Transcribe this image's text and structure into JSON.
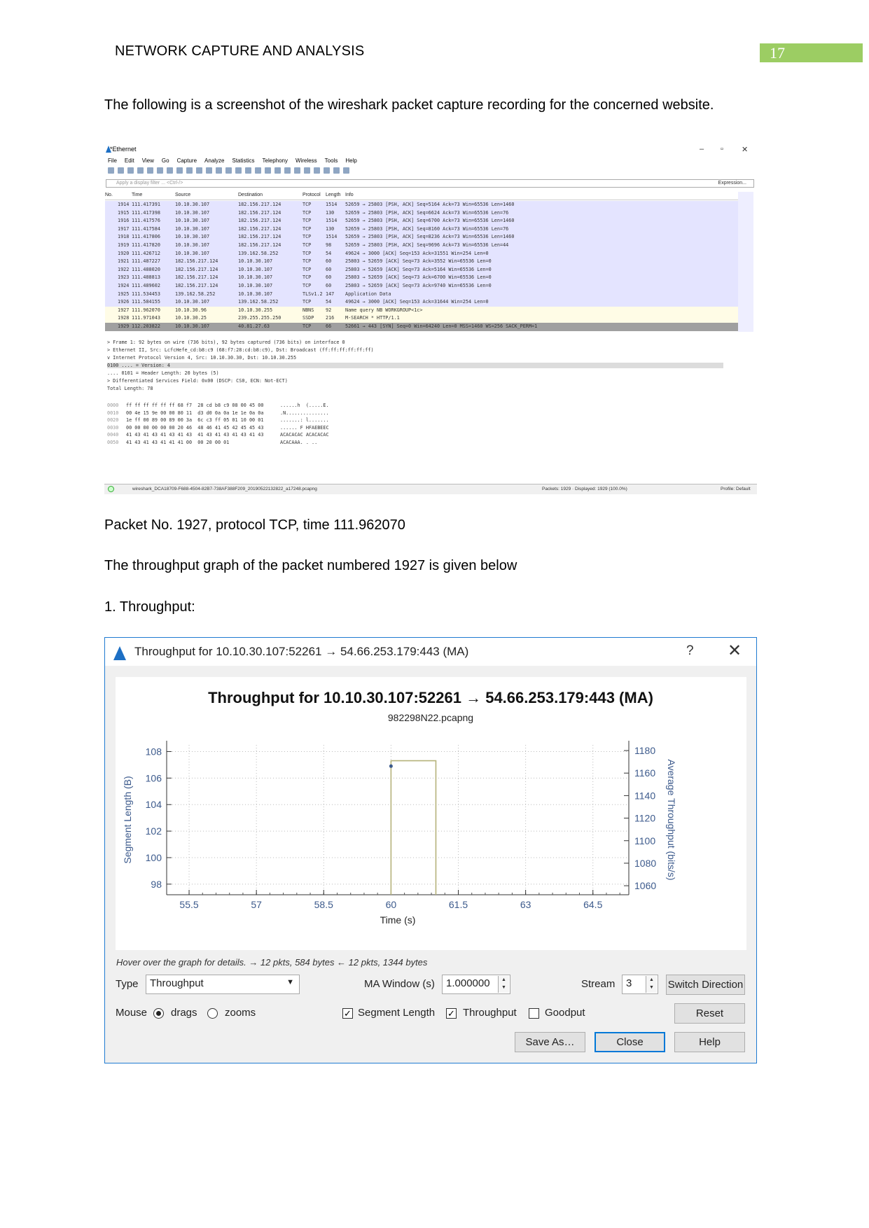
{
  "header": {
    "title": "NETWORK CAPTURE AND ANALYSIS",
    "page_number": "17"
  },
  "paragraphs": {
    "intro": "The following is a screenshot of the wireshark packet capture recording for the concerned website.",
    "packet_info": "Packet No. 1927, protocol TCP, time 111.962070",
    "graph_intro": "The throughput graph of the packet numbered 1927 is given below",
    "section": "1. Throughput:"
  },
  "wireshark": {
    "title": "*Ethernet",
    "menu": [
      "File",
      "Edit",
      "View",
      "Go",
      "Capture",
      "Analyze",
      "Statistics",
      "Telephony",
      "Wireless",
      "Tools",
      "Help"
    ],
    "filter_placeholder": "Apply a display filter ... <Ctrl-/>",
    "expression": "Expression...",
    "columns": [
      "No.",
      "Time",
      "Source",
      "Destination",
      "Protocol",
      "Length",
      "Info"
    ],
    "rows": [
      [
        "1914",
        "111.417391",
        "10.10.30.107",
        "182.156.217.124",
        "TCP",
        "1514",
        "52659 → 25803 [PSH, ACK] Seq=5164 Ack=73 Win=65536 Len=1460"
      ],
      [
        "1915",
        "111.417398",
        "10.10.30.107",
        "182.156.217.124",
        "TCP",
        "130",
        "52659 → 25803 [PSH, ACK] Seq=6624 Ack=73 Win=65536 Len=76"
      ],
      [
        "1916",
        "111.417576",
        "10.10.30.107",
        "182.156.217.124",
        "TCP",
        "1514",
        "52659 → 25803 [PSH, ACK] Seq=6700 Ack=73 Win=65536 Len=1460"
      ],
      [
        "1917",
        "111.417584",
        "10.10.30.107",
        "182.156.217.124",
        "TCP",
        "130",
        "52659 → 25803 [PSH, ACK] Seq=8160 Ack=73 Win=65536 Len=76"
      ],
      [
        "1918",
        "111.417806",
        "10.10.30.107",
        "182.156.217.124",
        "TCP",
        "1514",
        "52659 → 25803 [PSH, ACK] Seq=8236 Ack=73 Win=65536 Len=1460"
      ],
      [
        "1919",
        "111.417820",
        "10.10.30.107",
        "182.156.217.124",
        "TCP",
        "98",
        "52659 → 25803 [PSH, ACK] Seq=9696 Ack=73 Win=65536 Len=44"
      ],
      [
        "1920",
        "111.426712",
        "10.10.30.107",
        "139.162.58.252",
        "TCP",
        "54",
        "49624 → 3000 [ACK] Seq=153 Ack=31551 Win=254 Len=0"
      ],
      [
        "1921",
        "111.487227",
        "182.156.217.124",
        "10.10.30.107",
        "TCP",
        "60",
        "25803 → 52659 [ACK] Seq=73 Ack=3552 Win=65536 Len=0"
      ],
      [
        "1922",
        "111.488020",
        "182.156.217.124",
        "10.10.30.107",
        "TCP",
        "60",
        "25803 → 52659 [ACK] Seq=73 Ack=5164 Win=65536 Len=0"
      ],
      [
        "1923",
        "111.488813",
        "182.156.217.124",
        "10.10.30.107",
        "TCP",
        "60",
        "25803 → 52659 [ACK] Seq=73 Ack=6700 Win=65536 Len=0"
      ],
      [
        "1924",
        "111.489602",
        "182.156.217.124",
        "10.10.30.107",
        "TCP",
        "60",
        "25803 → 52659 [ACK] Seq=73 Ack=9740 Win=65536 Len=0"
      ],
      [
        "1925",
        "111.534453",
        "139.162.58.252",
        "10.10.30.107",
        "TLSv1.2",
        "147",
        "Application Data"
      ],
      [
        "1926",
        "111.584155",
        "10.10.30.107",
        "139.162.58.252",
        "TCP",
        "54",
        "49624 → 3000 [ACK] Seq=153 Ack=31644 Win=254 Len=0"
      ],
      [
        "1927",
        "111.962070",
        "10.10.30.96",
        "10.10.30.255",
        "NBNS",
        "92",
        "Name query NB WORKGROUP<1c>"
      ],
      [
        "1928",
        "111.971043",
        "10.10.30.25",
        "239.255.255.250",
        "SSDP",
        "216",
        "M-SEARCH * HTTP/1.1"
      ],
      [
        "1929",
        "112.203822",
        "10.10.30.107",
        "40.81.27.63",
        "TCP",
        "66",
        "52661 → 443 [SYN] Seq=0 Win=64240 Len=0 MSS=1460 WS=256 SACK_PERM=1"
      ]
    ],
    "details": [
      "> Frame 1: 92 bytes on wire (736 bits), 92 bytes captured (736 bits) on interface 0",
      "> Ethernet II, Src: LcfcHefe_cd:b8:c9 (68:f7:28:cd:b8:c9), Dst: Broadcast (ff:ff:ff:ff:ff:ff)",
      "v Internet Protocol Version 4, Src: 10.10.30.30, Dst: 10.10.30.255",
      "    0100 .... = Version: 4",
      "    .... 0101 = Header Length: 20 bytes (5)",
      "  > Differentiated Services Field: 0x00 (DSCP: CS0, ECN: Not-ECT)",
      "    Total Length: 78"
    ],
    "hex": [
      [
        "0000",
        "ff ff ff ff ff ff 68 f7  28 cd b8 c9 08 00 45 00",
        "......h  (.....E."
      ],
      [
        "0010",
        "00 4e 15 9e 00 00 80 11  d3 d0 0a 0a 1e 1e 0a 0a",
        ".N..............."
      ],
      [
        "0020",
        "1e ff 00 89 00 89 00 3a  6c c3 ff 05 01 10 00 01",
        ".......: l......."
      ],
      [
        "0030",
        "00 00 00 00 00 00 20 46  48 46 41 45 42 45 45 43",
        "...... F HFAEBEEC"
      ],
      [
        "0040",
        "41 43 41 43 41 43 41 43  41 43 41 43 41 43 41 43",
        "ACACACAC ACACACAC"
      ],
      [
        "0050",
        "41 43 41 43 41 41 41 00  00 20 00 01",
        "ACACAAA. . .."
      ]
    ],
    "status_file": "wireshark_DCA18709-F688-4504-82B7-738AF388F209_20190522132822_a17248.pcapng",
    "status_packets": "Packets: 1929 · Displayed: 1929 (100.0%)",
    "status_profile": "Profile: Default"
  },
  "dialog": {
    "window_title": "Throughput for 10.10.30.107:52261 → 54.66.253.179:443 (MA)",
    "help_glyph": "?",
    "close_glyph": "✕",
    "hint": "Hover over the graph for details. → 12 pkts, 584 bytes ← 12 pkts, 1344 bytes",
    "type_label": "Type",
    "type_value": "Throughput",
    "ma_label": "MA Window (s)",
    "ma_value": "1.000000",
    "stream_label": "Stream",
    "stream_value": "3",
    "switch_direction": "Switch Direction",
    "mouse_label": "Mouse",
    "drags_label": "drags",
    "zooms_label": "zooms",
    "segment_length_label": "Segment Length",
    "throughput_label": "Throughput",
    "goodput_label": "Goodput",
    "reset": "Reset",
    "save_as": "Save As…",
    "close": "Close",
    "help": "Help"
  },
  "chart_data": {
    "type": "line",
    "title": "Throughput for 10.10.30.107:52261 → 54.66.253.179:443 (MA)",
    "subtitle": "982298N22.pcapng",
    "xlabel": "Time (s)",
    "ylabel": "Segment Length (B)",
    "y2label": "Average Throughput (bits/s)",
    "xlim": [
      55.0,
      65.3
    ],
    "ylim": [
      97.2,
      108.5
    ],
    "y2lim": [
      1052,
      1185
    ],
    "x_ticks": [
      55.5,
      57,
      58.5,
      60,
      61.5,
      63,
      64.5
    ],
    "y_ticks": [
      98,
      100,
      102,
      104,
      106,
      108
    ],
    "y2_ticks": [
      1060,
      1080,
      1100,
      1120,
      1140,
      1160,
      1180
    ],
    "series": [
      {
        "name": "Segment Length",
        "axis": "y",
        "color": "#3c5a8c",
        "points": [
          [
            60.0,
            106.9
          ]
        ]
      },
      {
        "name": "Throughput",
        "axis": "y2",
        "color": "#b5b27a",
        "points": [
          [
            60.0,
            1052
          ],
          [
            60.0,
            1171
          ],
          [
            61.0,
            1171
          ],
          [
            61.0,
            1052
          ]
        ]
      }
    ],
    "colors": {
      "axis_labels": "#3c5a8c",
      "tick_labels": "#3c5a8c"
    }
  }
}
